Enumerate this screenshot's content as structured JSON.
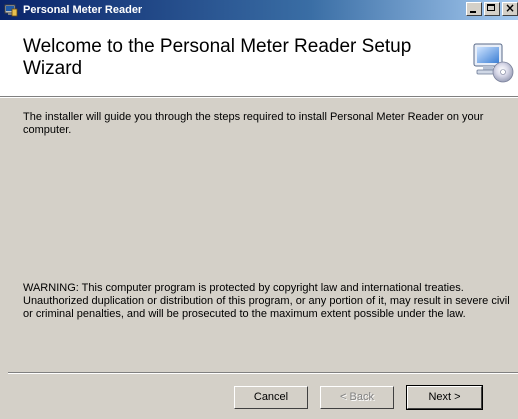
{
  "window": {
    "title": "Personal Meter Reader",
    "icon": "installer-icon",
    "controls": {
      "minimize": "minimize-icon",
      "maximize": "maximize-icon",
      "close_label": "×"
    }
  },
  "banner": {
    "heading": "Welcome to the Personal Meter Reader Setup Wizard",
    "icon": "computer-cd-icon"
  },
  "content": {
    "intro": "The installer will guide you through the steps required to install Personal Meter Reader on your computer.",
    "warning": "WARNING: This computer program is protected by copyright law and international treaties. Unauthorized duplication or distribution of this program, or any portion of it, may result in severe civil or criminal penalties, and will be prosecuted to the maximum extent possible under the law."
  },
  "buttons": {
    "cancel": "Cancel",
    "back": "< Back",
    "next": "Next >"
  },
  "colors": {
    "dialog_background": "#d4d0c8",
    "banner_background": "#ffffff",
    "titlebar_start": "#0a246a",
    "titlebar_end": "#a6caf0"
  }
}
